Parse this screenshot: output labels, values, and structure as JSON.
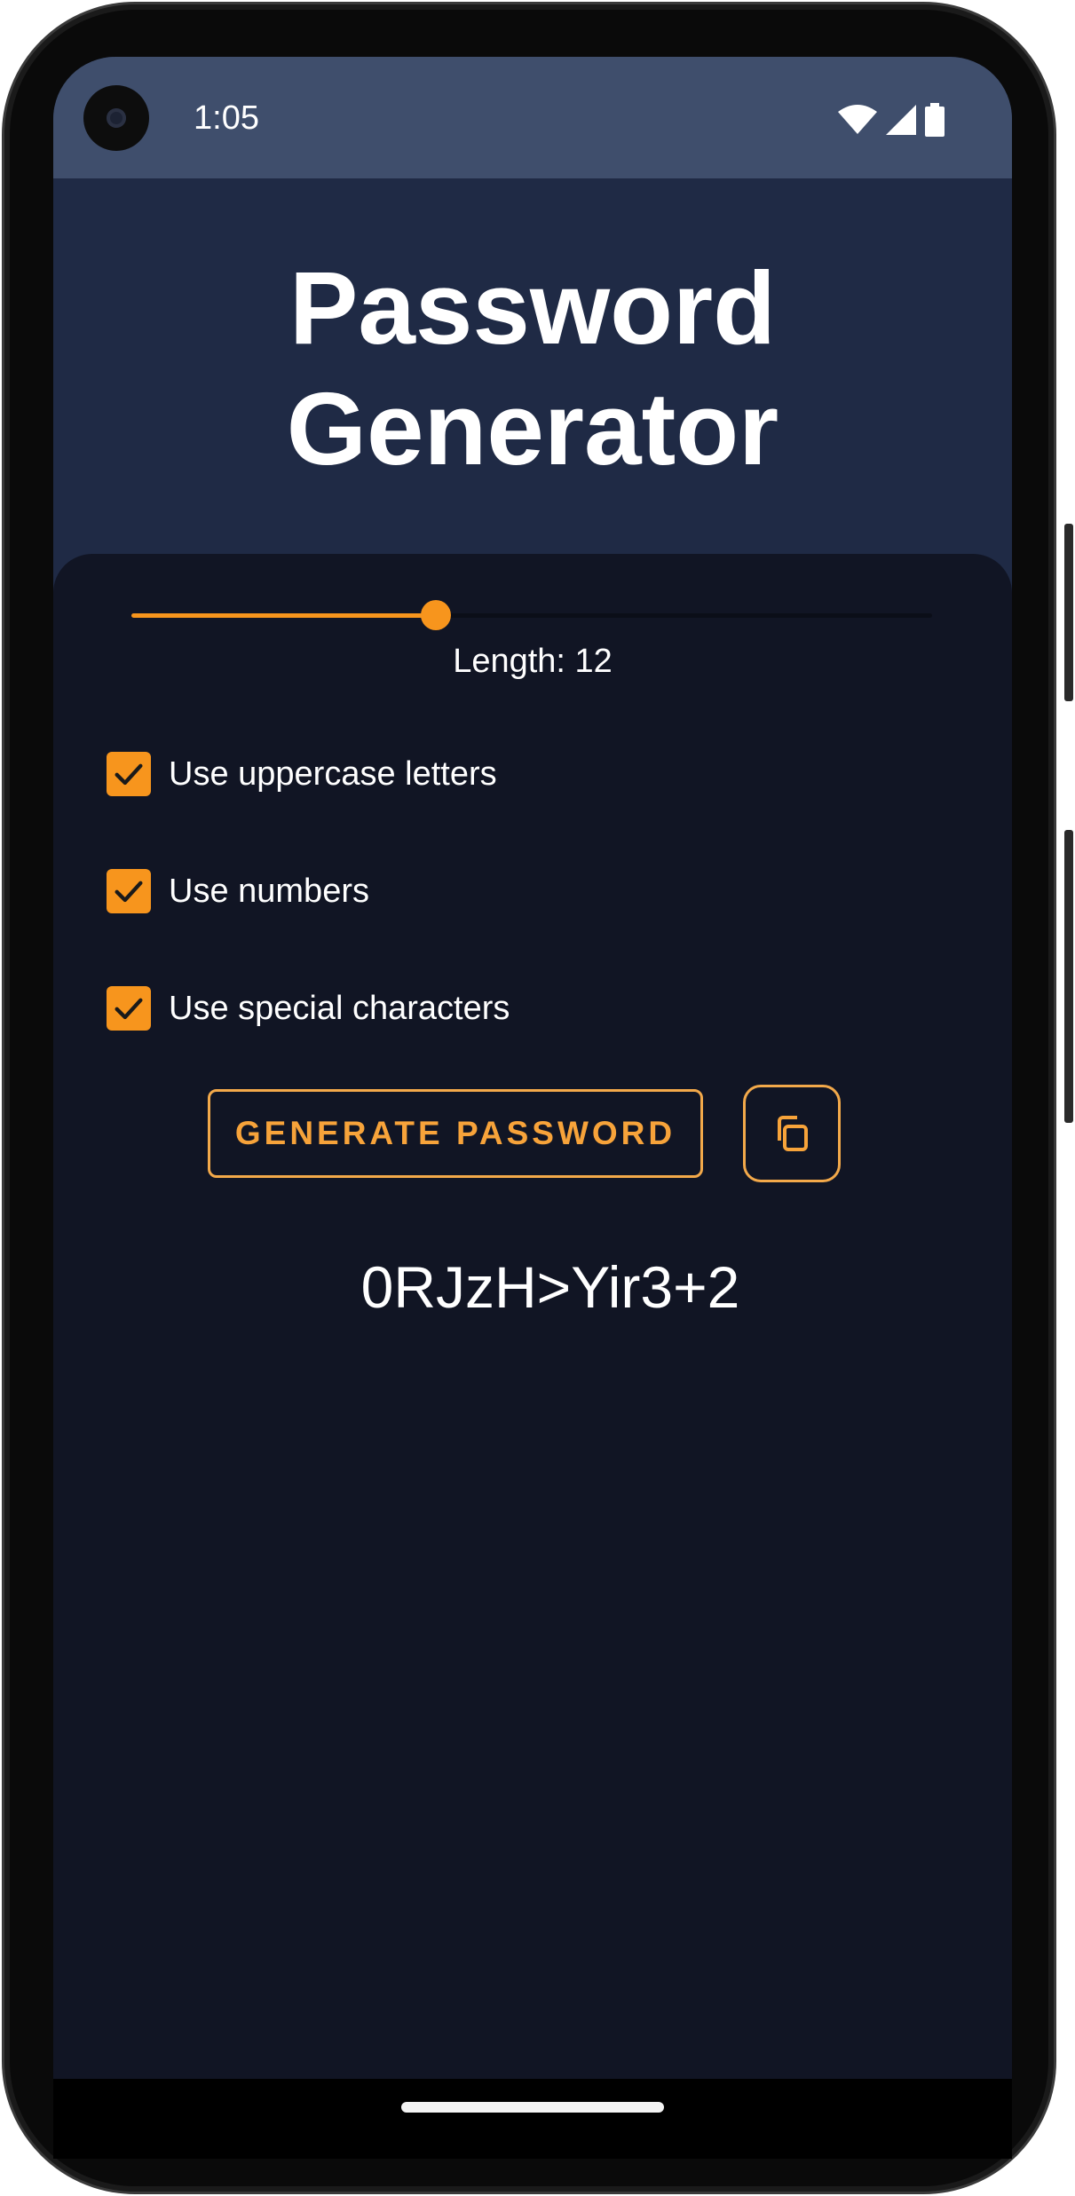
{
  "status_bar": {
    "time": "1:05",
    "icons": [
      "wifi-icon",
      "cellular-signal-icon",
      "battery-icon"
    ]
  },
  "app": {
    "title_line1": "Password",
    "title_line2": "Generator"
  },
  "slider": {
    "value": 12,
    "fraction": 0.38,
    "label": "Length: 12"
  },
  "options": [
    {
      "label": "Use uppercase letters",
      "checked": true
    },
    {
      "label": "Use numbers",
      "checked": true
    },
    {
      "label": "Use special characters",
      "checked": true
    }
  ],
  "actions": {
    "generate_label": "GENERATE PASSWORD",
    "copy_icon": "copy-icon"
  },
  "output": {
    "password": "0RJzH>Yir3+2"
  },
  "colors": {
    "accent": "#f7951d",
    "header_bg": "#1f2a45",
    "status_bar_bg": "#3f4e6c",
    "panel_bg": "#111524",
    "text": "#ffffff"
  }
}
